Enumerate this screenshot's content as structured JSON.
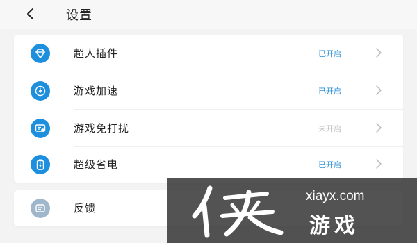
{
  "header": {
    "title": "设置",
    "back_icon": "chevron-left-icon"
  },
  "colors": {
    "accent": "#1e8fdc",
    "status_on": "#2b8fd6",
    "status_off": "#bdbdbd",
    "feedback_icon": "#9fb6cb"
  },
  "settings": [
    {
      "label": "超人插件",
      "status": "已开启",
      "enabled": true,
      "icon": "diamond-icon"
    },
    {
      "label": "游戏加速",
      "status": "已开启",
      "enabled": true,
      "icon": "lightning-icon"
    },
    {
      "label": "游戏免打扰",
      "status": "未开启",
      "enabled": false,
      "icon": "message-icon"
    },
    {
      "label": "超级省电",
      "status": "已开启",
      "enabled": true,
      "icon": "battery-icon"
    }
  ],
  "feedback": {
    "label": "反馈",
    "icon": "feedback-icon"
  },
  "watermark": {
    "url": "xiayx.com",
    "name": "游戏",
    "logo": "侠"
  }
}
